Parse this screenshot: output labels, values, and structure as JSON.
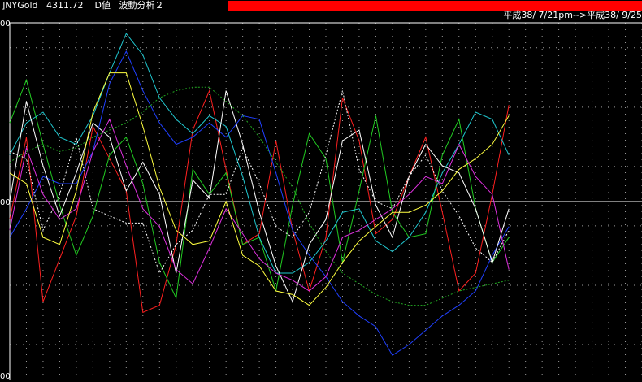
{
  "header": {
    "bracket": "]",
    "symbol": "NYGold",
    "price": "4311.72",
    "value_type": "D値",
    "indicator": "波動分析２",
    "bar_color": "#ff0000"
  },
  "date_range": "平成38/ 7/21pm-->平成38/ 9/25",
  "chart_data": {
    "type": "line",
    "x": [
      0,
      1,
      2,
      3,
      4,
      5,
      6,
      7,
      8,
      9,
      10,
      11,
      12,
      13,
      14,
      15,
      16,
      17,
      18,
      19,
      20,
      21,
      22,
      23,
      24,
      25,
      26,
      27,
      28,
      29,
      30,
      31,
      32,
      33,
      34,
      35,
      36,
      37,
      38
    ],
    "ylim": [
      0,
      100
    ],
    "ytick_labels": [
      "00",
      "00",
      "00"
    ],
    "midline": 50,
    "grid": true,
    "series": [
      {
        "color": "#ff2020",
        "dash": false,
        "values": [
          45,
          68,
          22,
          34,
          46,
          71,
          62,
          53,
          19,
          21,
          38,
          70,
          81,
          59,
          38,
          41,
          67,
          42,
          25,
          40,
          79,
          67,
          41,
          45,
          57,
          68,
          47,
          25,
          30,
          52,
          77
        ]
      },
      {
        "color": "#22cc22",
        "dash": false,
        "values": [
          72,
          84,
          66,
          49,
          35,
          46,
          63,
          68,
          55,
          33,
          23,
          59,
          52,
          58,
          38,
          40,
          25,
          49,
          69,
          62,
          33,
          53,
          74,
          47,
          40,
          41,
          63,
          73,
          48,
          33,
          40
        ]
      },
      {
        "color": "#2040ff",
        "dash": false,
        "values": [
          40,
          48,
          57,
          55,
          55,
          64,
          83,
          92,
          81,
          72,
          66,
          68,
          72,
          68,
          74,
          73,
          58,
          42,
          35,
          29,
          22,
          18,
          15,
          7,
          10,
          14,
          18,
          21,
          25,
          35,
          43
        ]
      },
      {
        "color": "#20c8d0",
        "dash": false,
        "values": [
          63,
          72,
          75,
          68,
          66,
          74,
          86,
          97,
          91,
          79,
          73,
          69,
          74,
          71,
          57,
          40,
          30,
          30,
          33,
          39,
          47,
          48,
          39,
          36,
          40,
          47,
          58,
          66,
          75,
          73,
          63
        ]
      },
      {
        "color": "#ffffff",
        "dash": false,
        "values": [
          50,
          78,
          60,
          46,
          58,
          72,
          68,
          53,
          61,
          52,
          30,
          56,
          51,
          81,
          66,
          47,
          32,
          22,
          38,
          45,
          67,
          70,
          49,
          40,
          57,
          66,
          60,
          58,
          48,
          33,
          48
        ]
      },
      {
        "color": "#ffffff",
        "dash": true,
        "values": [
          64,
          62,
          42,
          52,
          68,
          48,
          46,
          44,
          44,
          30,
          38,
          42,
          52,
          52,
          65,
          55,
          43,
          40,
          47,
          63,
          81,
          59,
          50,
          48,
          57,
          63,
          53,
          46,
          37,
          33,
          42
        ]
      },
      {
        "color": "#e030e0",
        "dash": false,
        "values": [
          42,
          65,
          52,
          45,
          48,
          64,
          73,
          60,
          48,
          43,
          31,
          27,
          37,
          48,
          41,
          34,
          30,
          28,
          25,
          29,
          40,
          42,
          45,
          48,
          52,
          57,
          55,
          66,
          57,
          52,
          31
        ]
      },
      {
        "color": "#ffff40",
        "dash": false,
        "values": [
          58,
          55,
          40,
          38,
          53,
          75,
          86,
          86,
          71,
          54,
          42,
          38,
          39,
          50,
          35,
          32,
          25,
          24,
          21,
          26,
          33,
          39,
          43,
          47,
          47,
          49,
          53,
          59,
          62,
          66,
          74
        ]
      },
      {
        "color": "#22aa22",
        "dash": true,
        "values": [
          61,
          64,
          66,
          64,
          65,
          68,
          70,
          72,
          75,
          79,
          81,
          82,
          82,
          78,
          74,
          68,
          61,
          54,
          44,
          36,
          30,
          27,
          24,
          22,
          21,
          21,
          23,
          25,
          26,
          27,
          28
        ]
      }
    ]
  }
}
